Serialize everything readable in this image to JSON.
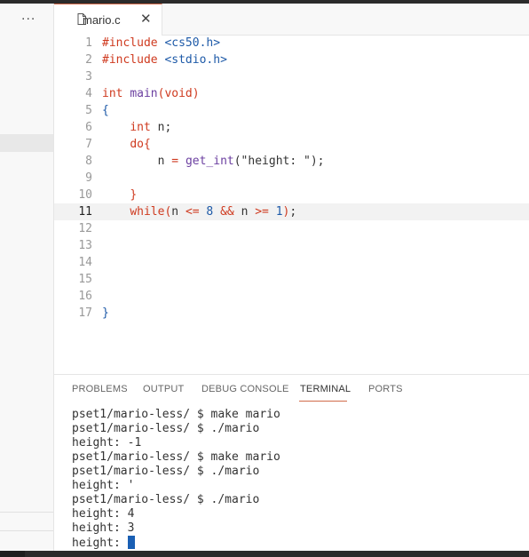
{
  "sidebar": {
    "more_label": "···"
  },
  "tab": {
    "label": "mario.c",
    "close": "✕"
  },
  "editor": {
    "current_line": 11,
    "lines": [
      {
        "n": "1",
        "parts": [
          [
            "pre",
            "#include "
          ],
          [
            "str",
            "<cs50.h>"
          ]
        ]
      },
      {
        "n": "2",
        "parts": [
          [
            "pre",
            "#include "
          ],
          [
            "str",
            "<stdio.h>"
          ]
        ]
      },
      {
        "n": "3",
        "parts": []
      },
      {
        "n": "4",
        "parts": [
          [
            "kw",
            "int "
          ],
          [
            "fn",
            "main"
          ],
          [
            "op",
            "("
          ],
          [
            "kw",
            "void"
          ],
          [
            "op",
            ")"
          ]
        ]
      },
      {
        "n": "5",
        "parts": [
          [
            "brace",
            "{"
          ]
        ]
      },
      {
        "n": "6",
        "parts": [
          [
            "",
            "    "
          ],
          [
            "kw",
            "int "
          ],
          [
            "",
            "n;"
          ]
        ]
      },
      {
        "n": "7",
        "parts": [
          [
            "",
            "    "
          ],
          [
            "kw",
            "do"
          ],
          [
            "op",
            "{"
          ]
        ]
      },
      {
        "n": "8",
        "parts": [
          [
            "",
            "        n "
          ],
          [
            "op",
            "= "
          ],
          [
            "fn",
            "get_int"
          ],
          [
            "",
            "(\"height: \");"
          ]
        ]
      },
      {
        "n": "9",
        "parts": []
      },
      {
        "n": "10",
        "parts": [
          [
            "",
            "    "
          ],
          [
            "op",
            "}"
          ]
        ]
      },
      {
        "n": "11",
        "parts": [
          [
            "",
            "    "
          ],
          [
            "kw",
            "while"
          ],
          [
            "op",
            "("
          ],
          [
            "",
            "n "
          ],
          [
            "op",
            "<= "
          ],
          [
            "num",
            "8 "
          ],
          [
            "op",
            "&& "
          ],
          [
            "",
            "n "
          ],
          [
            "op",
            ">= "
          ],
          [
            "num",
            "1"
          ],
          [
            "op",
            ")"
          ],
          [
            "",
            ";"
          ]
        ]
      },
      {
        "n": "12",
        "parts": []
      },
      {
        "n": "13",
        "parts": []
      },
      {
        "n": "14",
        "parts": []
      },
      {
        "n": "15",
        "parts": []
      },
      {
        "n": "16",
        "parts": []
      },
      {
        "n": "17",
        "parts": [
          [
            "brace",
            "}"
          ]
        ]
      }
    ]
  },
  "panel": {
    "tabs": [
      "PROBLEMS",
      "OUTPUT",
      "DEBUG CONSOLE",
      "TERMINAL",
      "PORTS"
    ],
    "active_tab": "TERMINAL",
    "terminal_lines": [
      "pset1/mario-less/ $ make mario",
      "pset1/mario-less/ $ ./mario",
      "height: -1",
      "pset1/mario-less/ $ make mario",
      "pset1/mario-less/ $ ./mario",
      "height: '",
      "pset1/mario-less/ $ ./mario",
      "height: 4",
      "height: 3",
      "height: "
    ]
  },
  "colors": {
    "accent": "#d16b4a",
    "cursor": "#1a5fb4"
  },
  "icons": {
    "file": "file-icon",
    "close": "close-icon",
    "more": "more-icon"
  }
}
